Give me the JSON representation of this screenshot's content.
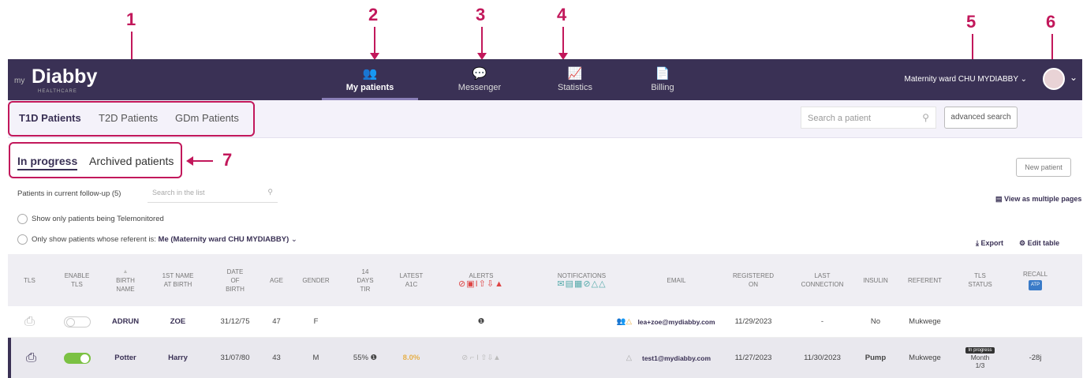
{
  "annotations": {
    "n1": "1",
    "n2": "2",
    "n3": "3",
    "n4": "4",
    "n5": "5",
    "n6": "6",
    "n7": "7"
  },
  "brand": {
    "prefix": "my",
    "name": "Diabby",
    "tagline": "HEALTHCARE"
  },
  "nav": [
    {
      "label": "My patients",
      "icon": "patients-icon",
      "glyph": "👥"
    },
    {
      "label": "Messenger",
      "icon": "messenger-icon",
      "glyph": "💬"
    },
    {
      "label": "Statistics",
      "icon": "statistics-icon",
      "glyph": "📈"
    },
    {
      "label": "Billing",
      "icon": "billing-icon",
      "glyph": "📄"
    }
  ],
  "ward": "Maternity ward CHU MYDIABBY",
  "patient_tabs": [
    "T1D Patients",
    "T2D Patients",
    "GDm Patients"
  ],
  "search": {
    "placeholder": "Search a patient",
    "advanced": "advanced search"
  },
  "status_tabs": [
    "In progress",
    "Archived patients"
  ],
  "new_patient": "New patient",
  "followup": {
    "label": "Patients in current follow-up (5)",
    "search_placeholder": "Search in the list"
  },
  "filters": {
    "telemonitored": "Show only patients being Telemonitored",
    "referent_prefix": "Only show patients whose referent is:",
    "referent_value": "Me (Maternity ward CHU MYDIABBY)"
  },
  "view_multiple": "View as multiple pages",
  "export": "Export",
  "edit_table": "Edit table",
  "columns": [
    "TLS",
    "ENABLE\nTLS",
    "BIRTH\nNAME",
    "1ST NAME\nAT BIRTH",
    "DATE\nOF\nBIRTH",
    "AGE",
    "GENDER",
    "14\nDAYS\nTIR",
    "LATEST\nA1C",
    "ALERTS",
    "NOTIFICATIONS",
    "EMAIL",
    "REGISTERED\nON",
    "LAST\nCONNECTION",
    "INSULIN",
    "REFERENT",
    "TLS\nSTATUS",
    "RECALL"
  ],
  "recall_badge": "ATP",
  "rows": [
    {
      "enabled": false,
      "birth_name": "ADRUN",
      "first_name": "ZOE",
      "dob": "31/12/75",
      "age": "47",
      "gender": "F",
      "tir": "",
      "a1c": "",
      "alerts": "❶",
      "notifications": "👥△",
      "email": "lea+zoe@mydiabby.com",
      "registered": "11/29/2023",
      "last_connection": "-",
      "insulin": "No",
      "referent": "Mukwege",
      "tls_status_badge": "",
      "tls_status": "",
      "recall": ""
    },
    {
      "enabled": true,
      "birth_name": "Potter",
      "first_name": "Harry",
      "dob": "31/07/80",
      "age": "43",
      "gender": "M",
      "tir": "55% ❶",
      "a1c": "8.0%",
      "alerts": "⊘ ⌐ I ⇧⇩▲",
      "notifications": "△",
      "email": "test1@mydiabby.com",
      "registered": "11/27/2023",
      "last_connection": "11/30/2023",
      "insulin": "Pump",
      "referent": "Mukwege",
      "tls_status_badge": "In progress",
      "tls_status": "Month\n1/3",
      "recall": "-28j"
    }
  ],
  "colors": {
    "header": "#3a3155",
    "accent": "#c2185b",
    "toggle_on": "#7bc143"
  }
}
